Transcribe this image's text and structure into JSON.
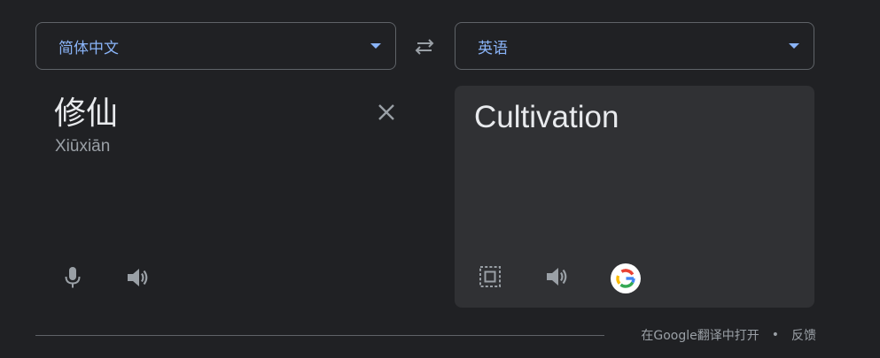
{
  "source": {
    "language": "简体中文",
    "text": "修仙",
    "romanization": "Xiūxiān"
  },
  "target": {
    "language": "英语",
    "text": "Cultivation"
  },
  "footer": {
    "open_link": "在Google翻译中打开",
    "separator": "•",
    "feedback_link": "反馈"
  },
  "colors": {
    "background": "#202124",
    "panel": "#303134",
    "accent": "#8ab4f8",
    "text": "#e8eaed",
    "muted": "#9aa0a6",
    "border": "#5f6368"
  },
  "icons": {
    "swap": "swap-arrows-icon",
    "clear": "close-icon",
    "mic": "microphone-icon",
    "speaker": "speaker-icon",
    "copy": "copy-icon",
    "google": "google-logo-icon"
  }
}
